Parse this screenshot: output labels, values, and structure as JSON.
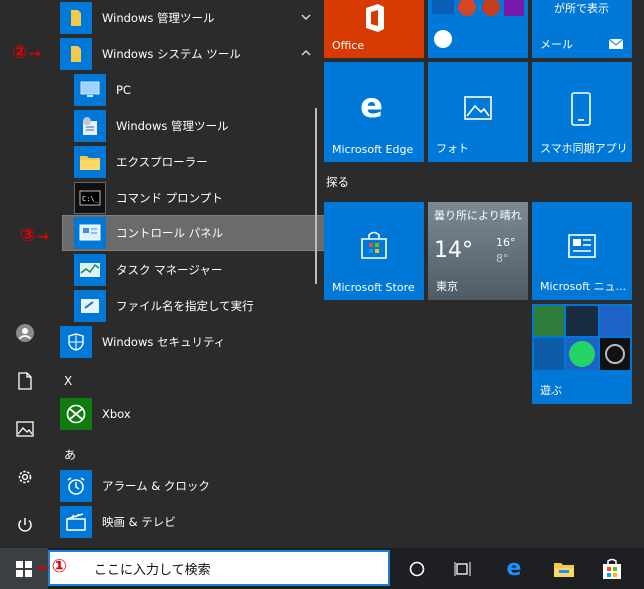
{
  "annotations": {
    "one": "①",
    "two": "②",
    "three": "③"
  },
  "app_list": {
    "folders": [
      {
        "label": "Windows 管理ツール"
      },
      {
        "label": "Windows システム ツール"
      }
    ],
    "system_tools": [
      {
        "label": "PC"
      },
      {
        "label": "Windows 管理ツール"
      },
      {
        "label": "エクスプローラー"
      },
      {
        "label": "コマンド プロンプト"
      },
      {
        "label": "コントロール パネル"
      },
      {
        "label": "タスク マネージャー"
      },
      {
        "label": "ファイル名を指定して実行"
      }
    ],
    "security": {
      "label": "Windows セキュリティ"
    },
    "section_x": "X",
    "xbox": {
      "label": "Xbox"
    },
    "section_a": "あ",
    "alarm": {
      "label": "アラーム & クロック"
    },
    "movies": {
      "label": "映画 & テレビ"
    }
  },
  "tiles": {
    "office": {
      "label": "Office"
    },
    "mail": {
      "label": "メール",
      "top_text": "が所で表示"
    },
    "edge": {
      "label": "Microsoft Edge"
    },
    "photos": {
      "label": "フォト"
    },
    "phone": {
      "label": "スマホ同期アプリ"
    },
    "section_explore": "探る",
    "store": {
      "label": "Microsoft Store"
    },
    "weather": {
      "condition": "曇り所により晴れ",
      "temp": "14°",
      "high": "16°",
      "low": "8°",
      "city": "東京"
    },
    "news": {
      "label": "Microsoft ニュ..."
    },
    "play": {
      "label": "遊ぶ"
    }
  },
  "taskbar": {
    "search_placeholder": "ここに入力して検索"
  },
  "colors": {
    "tile_blue": "#0078d7",
    "office_orange": "#d83b01",
    "annotation_red": "#e00000",
    "xbox_green": "#107c10"
  }
}
